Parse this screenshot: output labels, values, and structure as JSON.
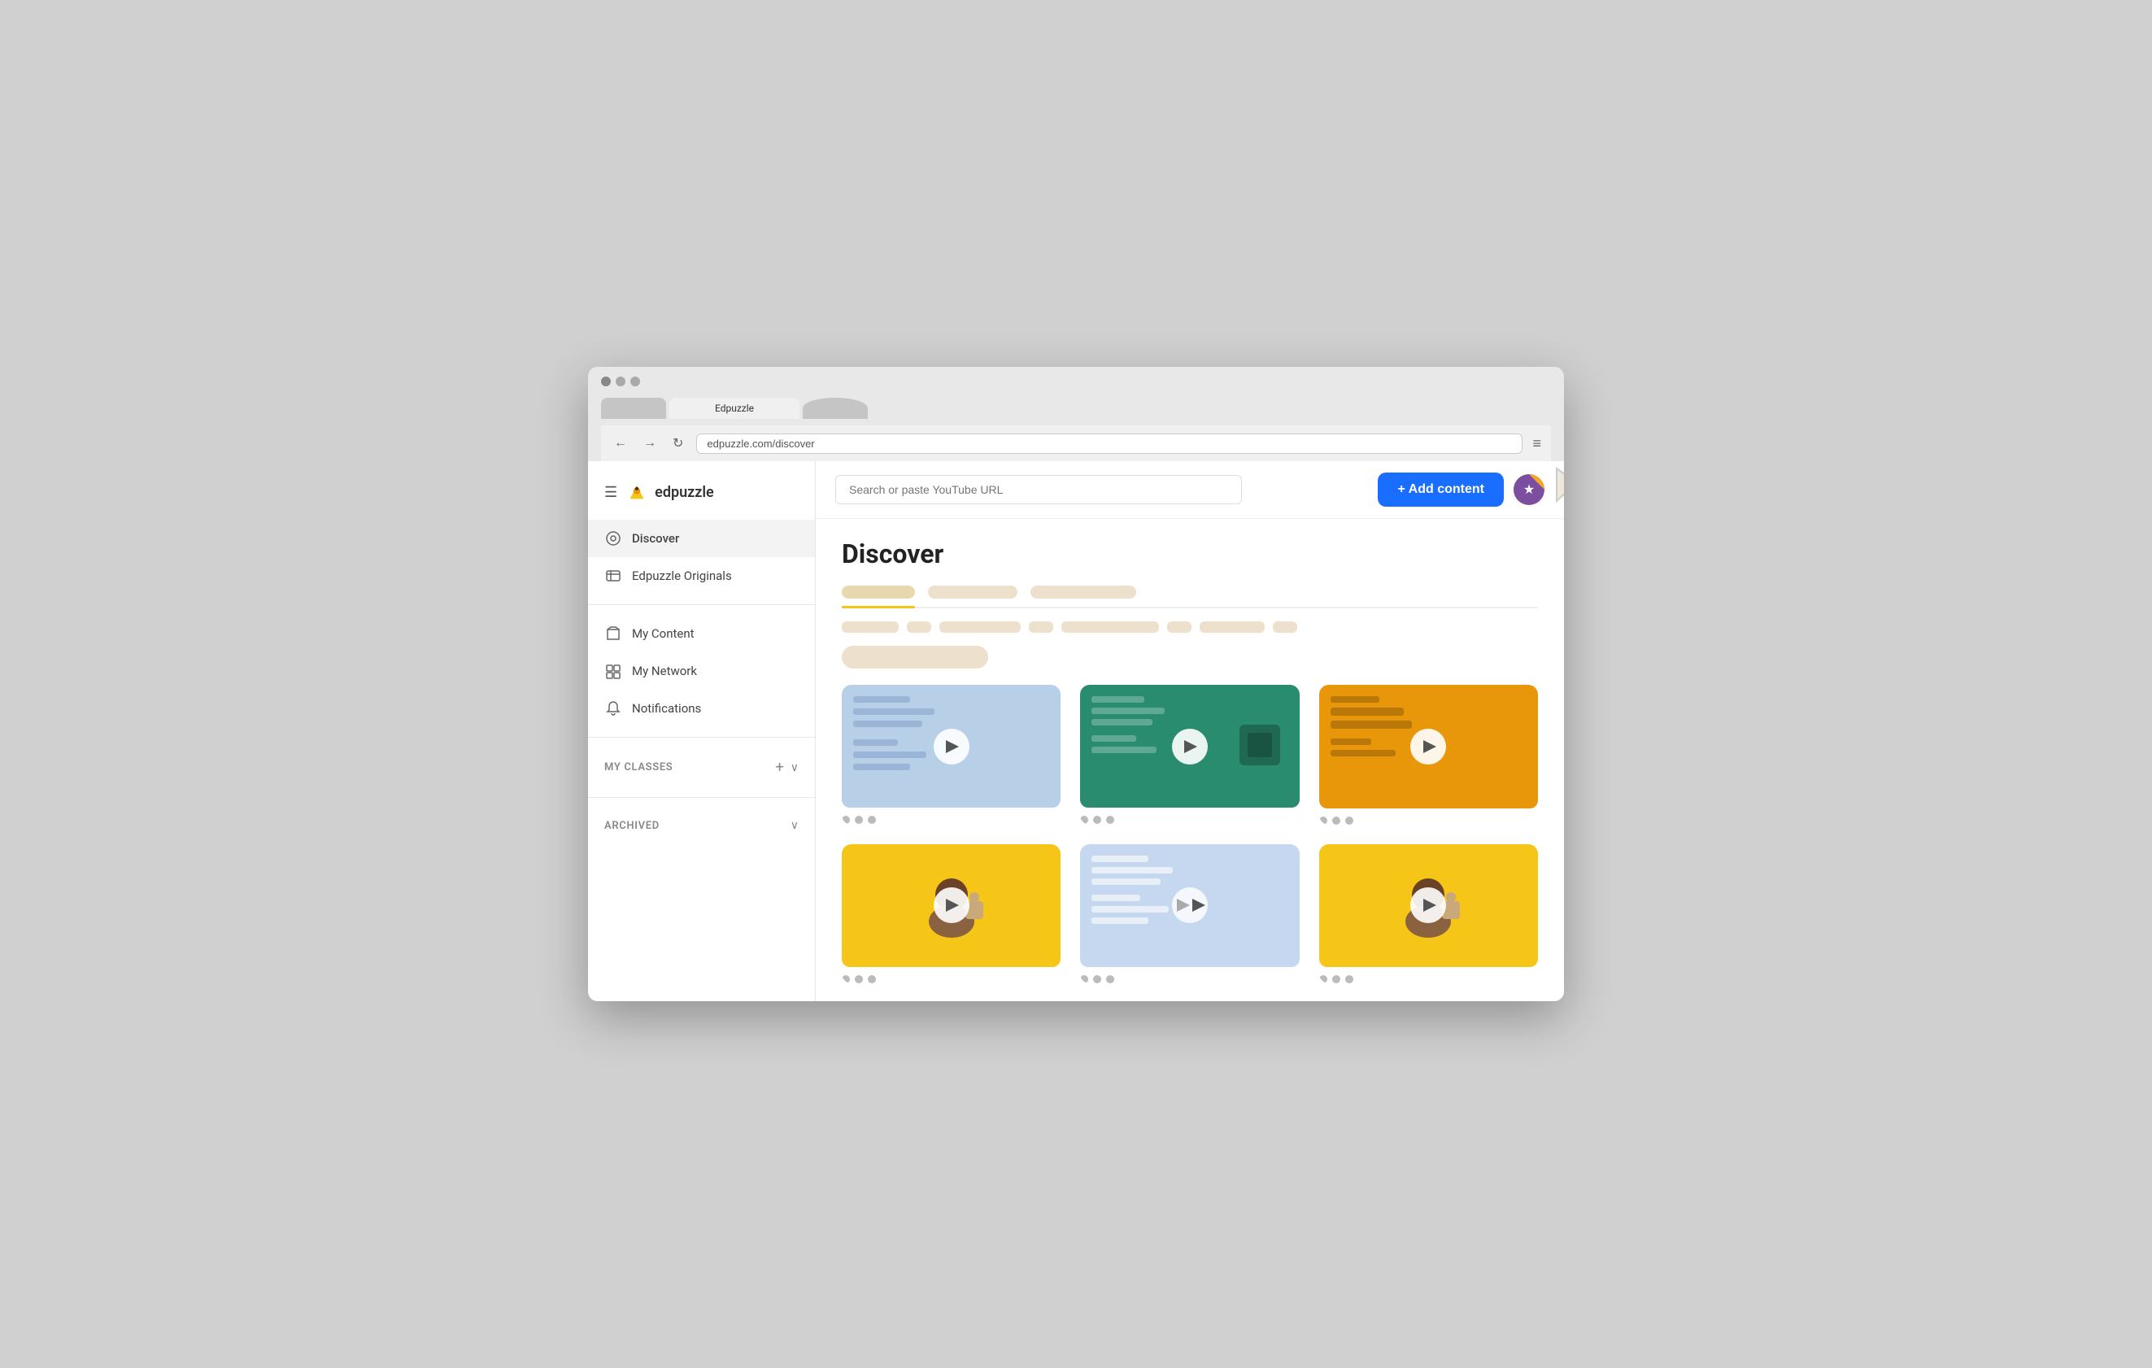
{
  "browser": {
    "tab_label": "Edpuzzle",
    "nav_back": "←",
    "nav_forward": "→",
    "nav_refresh": "↻",
    "menu_icon": "≡"
  },
  "header": {
    "logo_text": "edpuzzle",
    "search_placeholder": "Search or paste YouTube URL",
    "add_content_label": "+ Add content"
  },
  "sidebar": {
    "hamburger": "☰",
    "nav_items": [
      {
        "id": "discover",
        "label": "Discover",
        "active": true
      },
      {
        "id": "originals",
        "label": "Edpuzzle Originals",
        "active": false
      },
      {
        "id": "my-content",
        "label": "My Content",
        "active": false
      },
      {
        "id": "my-network",
        "label": "My Network",
        "active": false
      },
      {
        "id": "notifications",
        "label": "Notifications",
        "active": false
      }
    ],
    "classes_label": "MY CLASSES",
    "archived_label": "ARCHIVED"
  },
  "main": {
    "page_title": "Discover"
  }
}
